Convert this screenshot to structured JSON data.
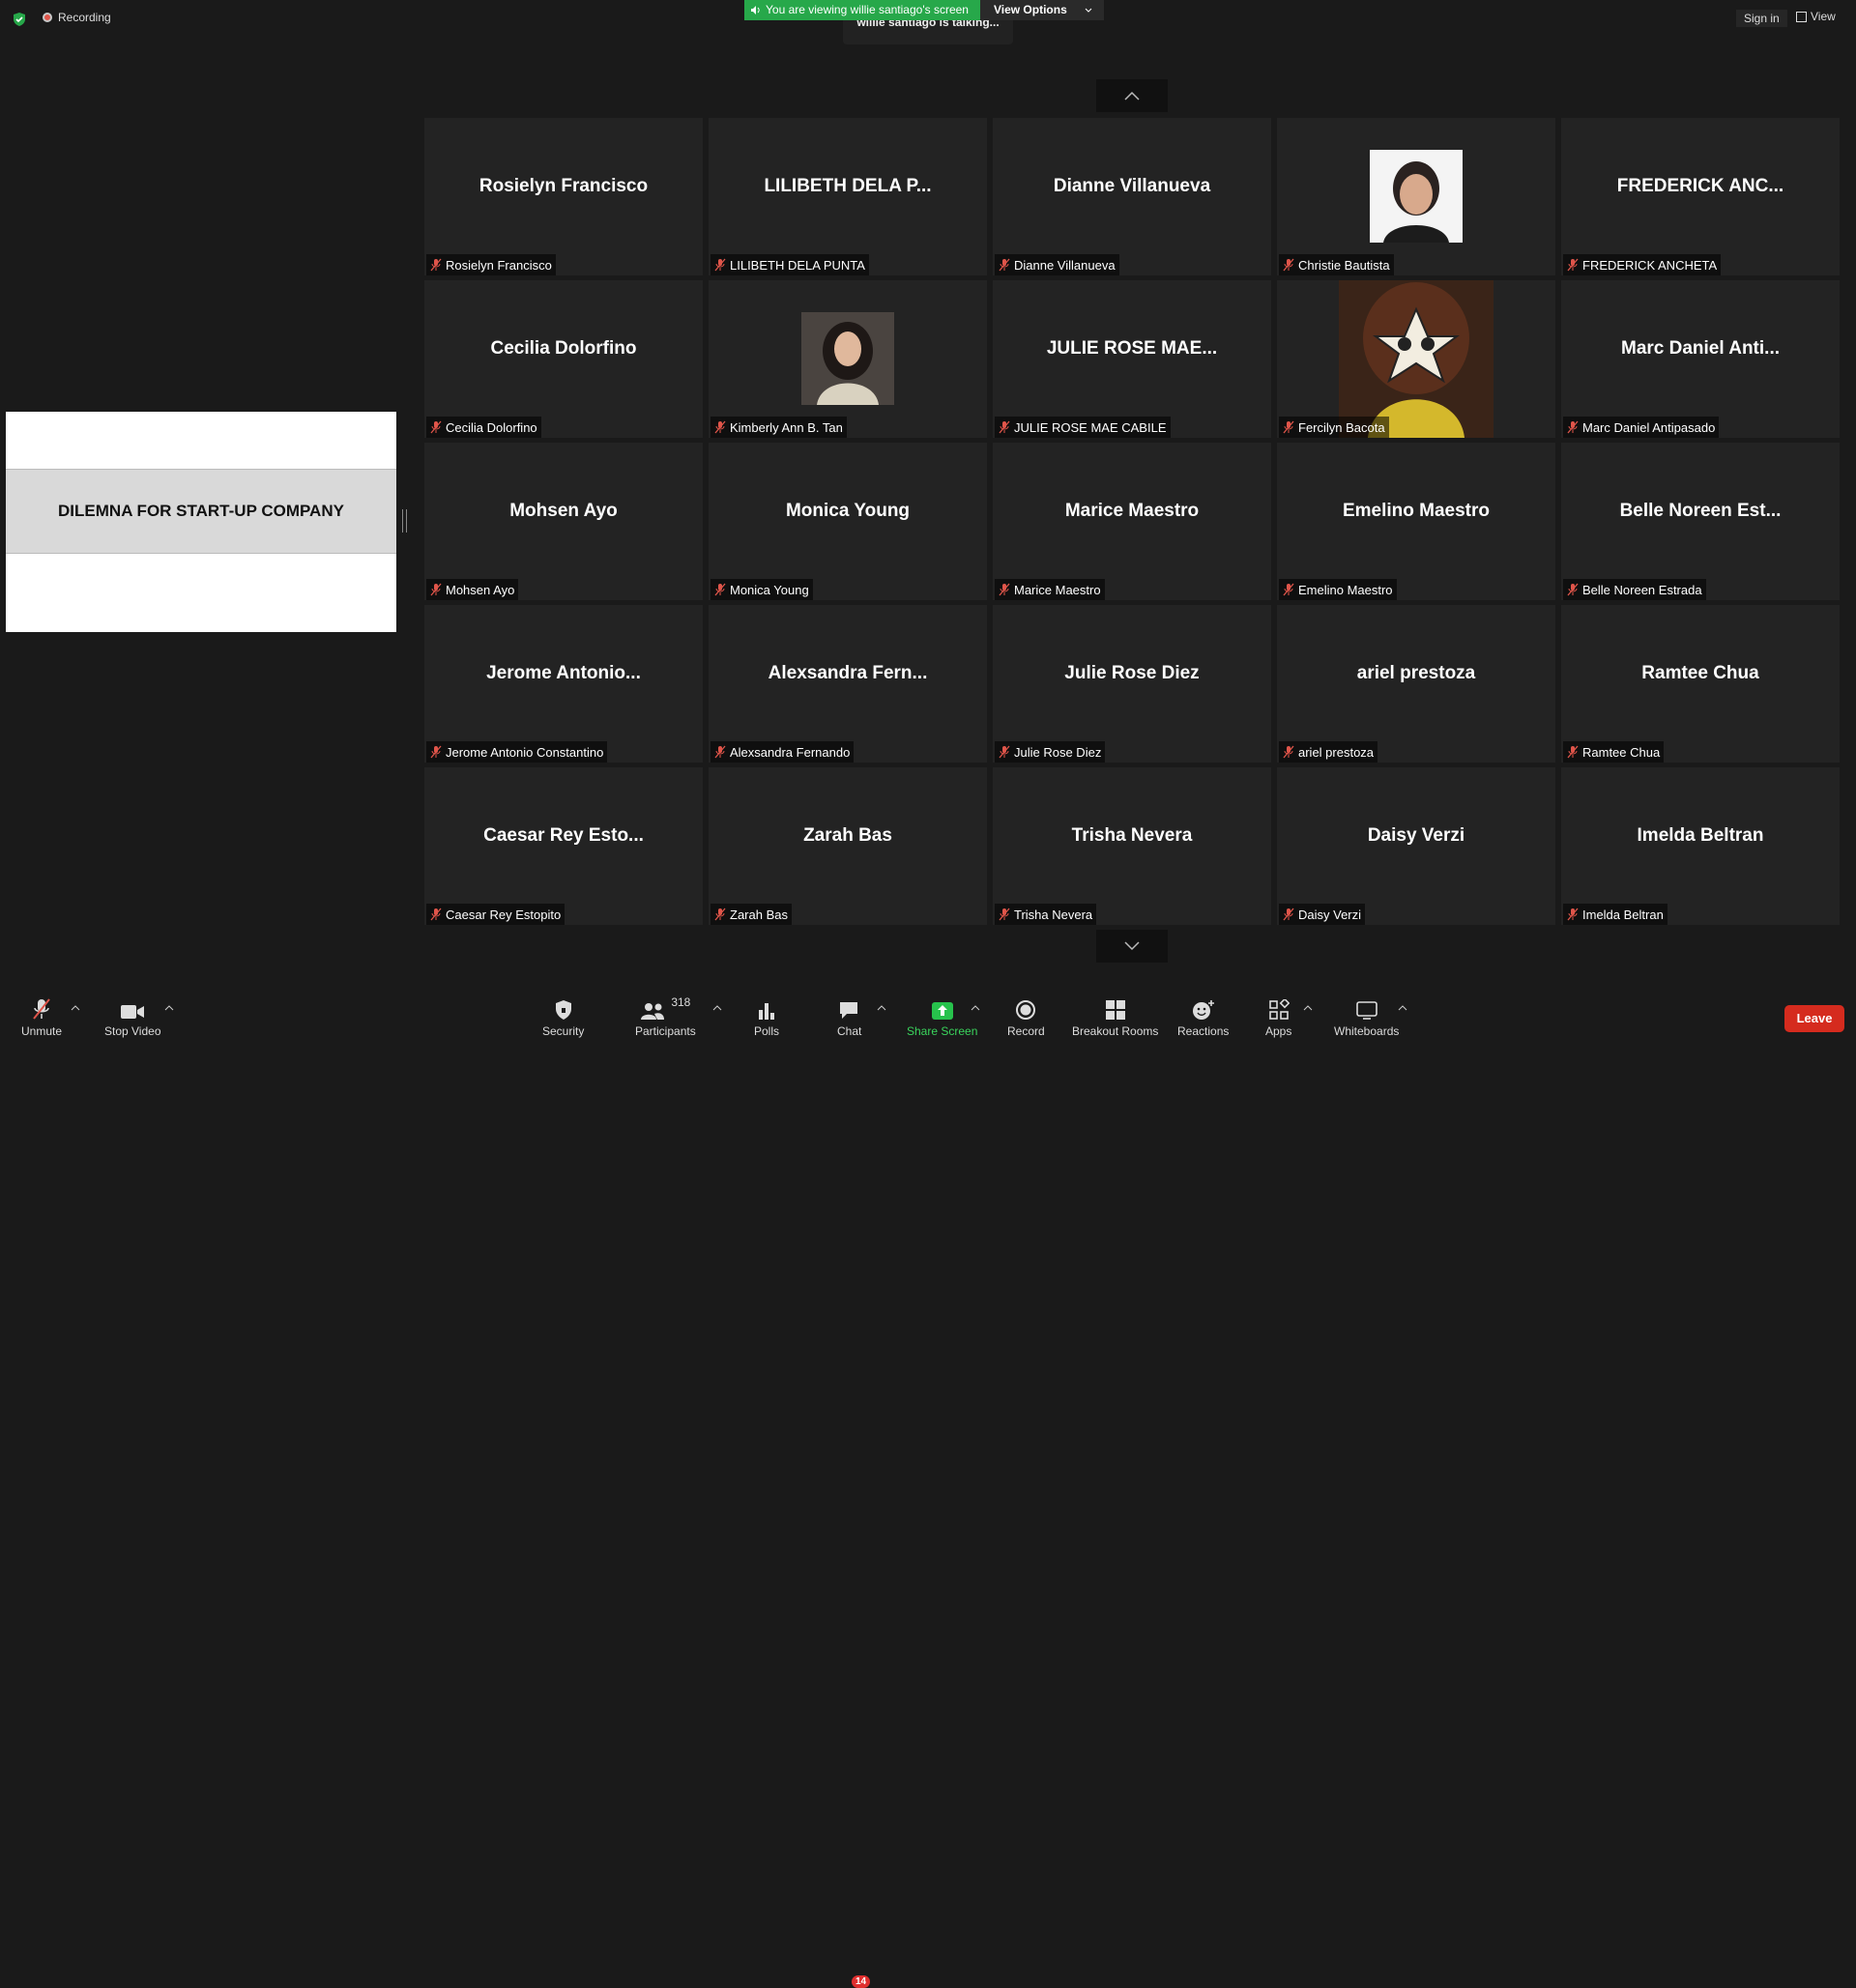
{
  "top": {
    "recording_label": "Recording",
    "banner_text": "You are viewing willie santiago's screen",
    "view_options_label": "View Options",
    "talking_text": "willie santiago is talking...",
    "sign_in_label": "Sign in",
    "view_label": "View"
  },
  "share": {
    "slide_title": "DILEMNA FOR START-UP COMPANY"
  },
  "participants": [
    {
      "display": "Rosielyn Francisco",
      "name": "Rosielyn Francisco"
    },
    {
      "display": "LILIBETH DELA P...",
      "name": "LILIBETH DELA PUNTA"
    },
    {
      "display": "Dianne Villanueva",
      "name": "Dianne Villanueva"
    },
    {
      "display": "",
      "name": "Christie Bautista"
    },
    {
      "display": "FREDERICK ANC...",
      "name": "FREDERICK ANCHETA"
    },
    {
      "display": "Cecilia Dolorfino",
      "name": "Cecilia Dolorfino"
    },
    {
      "display": "",
      "name": "Kimberly Ann B. Tan"
    },
    {
      "display": "JULIE ROSE MAE...",
      "name": "JULIE ROSE MAE CABILE"
    },
    {
      "display": "",
      "name": "Fercilyn Bacota"
    },
    {
      "display": "Marc Daniel Anti...",
      "name": "Marc Daniel Antipasado"
    },
    {
      "display": "Mohsen Ayo",
      "name": "Mohsen Ayo"
    },
    {
      "display": "Monica Young",
      "name": "Monica Young"
    },
    {
      "display": "Marice Maestro",
      "name": "Marice Maestro"
    },
    {
      "display": "Emelino Maestro",
      "name": "Emelino Maestro"
    },
    {
      "display": "Belle Noreen Est...",
      "name": "Belle Noreen Estrada"
    },
    {
      "display": "Jerome  Antonio...",
      "name": "Jerome Antonio Constantino"
    },
    {
      "display": "Alexsandra  Fern...",
      "name": "Alexsandra Fernando"
    },
    {
      "display": "Julie Rose Diez",
      "name": "Julie Rose Diez"
    },
    {
      "display": "ariel prestoza",
      "name": "ariel prestoza"
    },
    {
      "display": "Ramtee Chua",
      "name": "Ramtee Chua"
    },
    {
      "display": "Caesar Rey Esto...",
      "name": "Caesar Rey Estopito"
    },
    {
      "display": "Zarah Bas",
      "name": "Zarah Bas"
    },
    {
      "display": "Trisha Nevera",
      "name": "Trisha Nevera"
    },
    {
      "display": "Daisy Verzi",
      "name": "Daisy Verzi"
    },
    {
      "display": "Imelda Beltran",
      "name": "Imelda Beltran"
    }
  ],
  "toolbar": {
    "unmute": "Unmute",
    "stop_video": "Stop Video",
    "security": "Security",
    "participants": "Participants",
    "participants_count": "318",
    "polls": "Polls",
    "chat": "Chat",
    "chat_badge": "14",
    "share_screen": "Share Screen",
    "record": "Record",
    "breakout_rooms": "Breakout Rooms",
    "reactions": "Reactions",
    "apps": "Apps",
    "whiteboards": "Whiteboards",
    "leave": "Leave"
  },
  "colors": {
    "accent_green": "#27a84a",
    "leave_red": "#d52b1e",
    "muted_red": "#e0554a"
  }
}
